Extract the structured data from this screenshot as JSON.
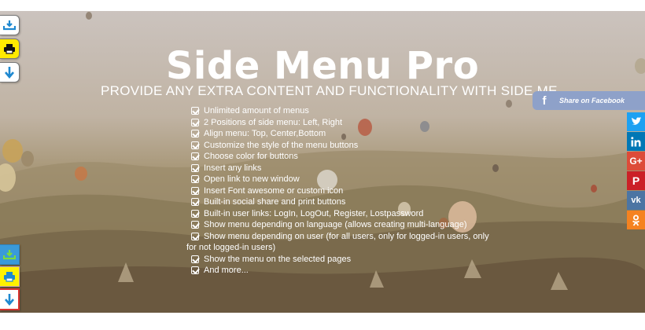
{
  "header": {
    "title": "Side Menu Pro",
    "subtitle": "PROVIDE ANY EXTRA CONTENT AND FUNCTIONALITY WITH SIDE MENU"
  },
  "features": [
    "Unlimited amount of menus",
    "2 Positions of side menu: Left, Right",
    "Align menu: Top, Center,Bottom",
    "Customize the style of the menu buttons",
    "Choose color for buttons",
    "Insert any links",
    "Open link to new window",
    "Insert Font awesome or custom icon",
    "Built-in social share and print buttons",
    "Built-in user links: LogIn, LogOut, Register, Lostpassword",
    "Show menu depending on language (allows creating multi-language)",
    "Show menu depending on user (for all users, only for logged-in users, only",
    "for not logged-in users)",
    "Show the menu on the selected pages",
    "And more..."
  ],
  "left_menu_top": [
    {
      "icon": "download-tray-icon",
      "style": "white"
    },
    {
      "icon": "printer-icon",
      "style": "yellow"
    },
    {
      "icon": "download-arrow-icon",
      "style": "white"
    }
  ],
  "left_menu_bottom": [
    {
      "icon": "download-tray-icon",
      "style": "blue"
    },
    {
      "icon": "printer-icon",
      "style": "yellow"
    },
    {
      "icon": "download-arrow-icon",
      "style": "white-red"
    }
  ],
  "share": {
    "facebook_label": "Share on Facebook",
    "facebook_glyph": "f",
    "buttons": [
      {
        "icon": "twitter-icon",
        "color": "#1da1f2"
      },
      {
        "icon": "linkedin-icon",
        "color": "#0077b5"
      },
      {
        "icon": "google-plus-icon",
        "color": "#dd4b39",
        "glyph": "G+"
      },
      {
        "icon": "pinterest-icon",
        "color": "#cb2027",
        "glyph": "P"
      },
      {
        "icon": "vk-icon",
        "color": "#4c75a3",
        "glyph": "vk"
      },
      {
        "icon": "odnoklassniki-icon",
        "color": "#f58220",
        "glyph": "ok"
      }
    ]
  },
  "colors": {
    "facebook": "#8ea1c9",
    "icon_blue": "#1e88d0",
    "yellow": "#ffea00"
  }
}
